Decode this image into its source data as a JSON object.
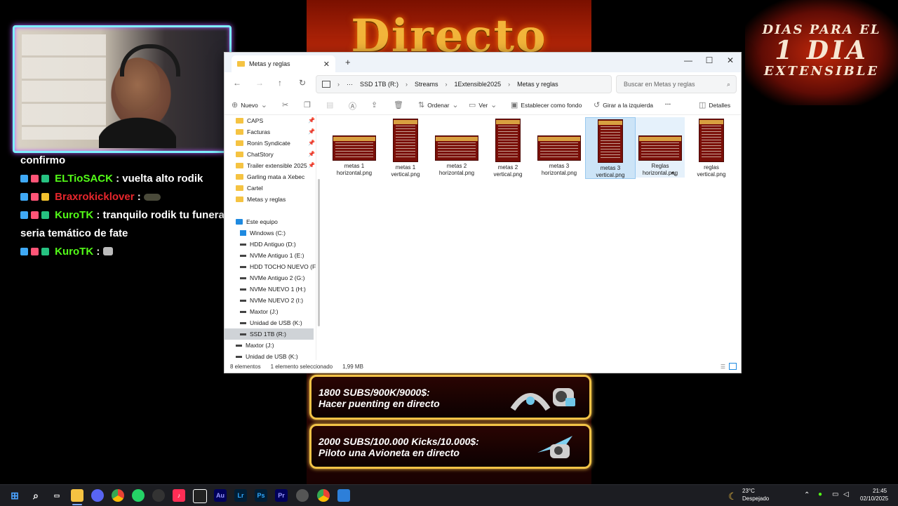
{
  "overlay": {
    "center_title": "Directo",
    "countdown": {
      "line1": "DIAS PARA EL",
      "line2": "1 DIA",
      "line3": "EXTENSIBLE"
    }
  },
  "chat": [
    {
      "user": "",
      "text": "confirmo"
    },
    {
      "user": "ELTioSACK",
      "sep": " : ",
      "text": "vuelta alto rodik"
    },
    {
      "user": "Braxrokicklover",
      "sep": " : ",
      "text": ""
    },
    {
      "user": "KuroTK",
      "sep": " : ",
      "text": "tranquilo rodik tu funeral"
    },
    {
      "user": "",
      "text": "seria temático de fate"
    },
    {
      "user": "KuroTK",
      "sep": " : ",
      "text": ""
    }
  ],
  "explorer": {
    "tab_title": "Metas y reglas",
    "breadcrumb": [
      "SSD 1TB (R:)",
      "Streams",
      "1Extensible2025",
      "Metas y reglas"
    ],
    "more_crumbs": "···",
    "search_placeholder": "Buscar en Metas y reglas",
    "toolbar": {
      "new": "Nuevo",
      "sort": "Ordenar",
      "view": "Ver",
      "set_background": "Establecer como fondo",
      "rotate_left": "Girar a la izquierda",
      "more": "···",
      "details": "Detalles"
    },
    "sidebar_pinned": [
      "CAPS",
      "Facturas",
      "Ronin Syndicate",
      "ChatStory",
      "Trailer extensible 2025",
      "Garling mata a Xebec",
      "Cartel",
      "Metas y reglas"
    ],
    "this_pc": "Este equipo",
    "drives": [
      "Windows (C:)",
      "HDD Antiguo (D:)",
      "NVMe Antiguo 1 (E:)",
      "HDD TOCHO NUEVO (F:)",
      "NVMe Antiguo 2 (G:)",
      "NVMe NUEVO 1 (H:)",
      "NVMe NUEVO 2 (I:)",
      "Maxtor (J:)",
      "Unidad de USB (K:)",
      "SSD 1TB (R:)"
    ],
    "root_items": [
      "Maxtor (J:)",
      "Unidad de USB (K:)"
    ],
    "files": [
      {
        "name1": "metas 1",
        "name2": "horizontal.png",
        "orientation": "h"
      },
      {
        "name1": "metas 1",
        "name2": "vertical.png",
        "orientation": "v"
      },
      {
        "name1": "metas 2",
        "name2": "horizontal.png",
        "orientation": "h"
      },
      {
        "name1": "metas 2",
        "name2": "vertical.png",
        "orientation": "v"
      },
      {
        "name1": "metas 3",
        "name2": "horizontal.png",
        "orientation": "h"
      },
      {
        "name1": "metas 3",
        "name2": "vertical.png",
        "orientation": "v",
        "selected": true
      },
      {
        "name1": "Reglas",
        "name2": "horizontal.png",
        "orientation": "h",
        "hover": true
      },
      {
        "name1": "reglas",
        "name2": "vertical.png",
        "orientation": "v"
      }
    ],
    "status": {
      "count": "8 elementos",
      "selection": "1 elemento seleccionado",
      "size": "1,99 MB"
    }
  },
  "goals": [
    {
      "line1": "1800 SUBS/900K/9000$:",
      "line2": "Hacer puenting en directo"
    },
    {
      "line1": "2000 SUBS/100.000 Kicks/10.000$:",
      "line2": "Piloto una Avioneta en directo"
    }
  ],
  "taskbar": {
    "apps": [
      "start-icon",
      "search-icon",
      "task-view-icon",
      "file-explorer-icon",
      "discord-icon",
      "chrome-icon",
      "whatsapp-icon",
      "obs-icon",
      "tiktok-icon",
      "capcut-icon",
      "audition-icon",
      "lightroom-icon",
      "photoshop-icon",
      "premiere-icon",
      "settings-icon",
      "chrome-alt-icon",
      "photos-icon"
    ],
    "weather_temp": "23°C",
    "weather_desc": "Despejado",
    "time": "21:45",
    "date": "02/10/2025"
  },
  "colors": {
    "accent": "#1f8ae0",
    "kick_green": "#53fc18",
    "gold": "#f3c447"
  }
}
